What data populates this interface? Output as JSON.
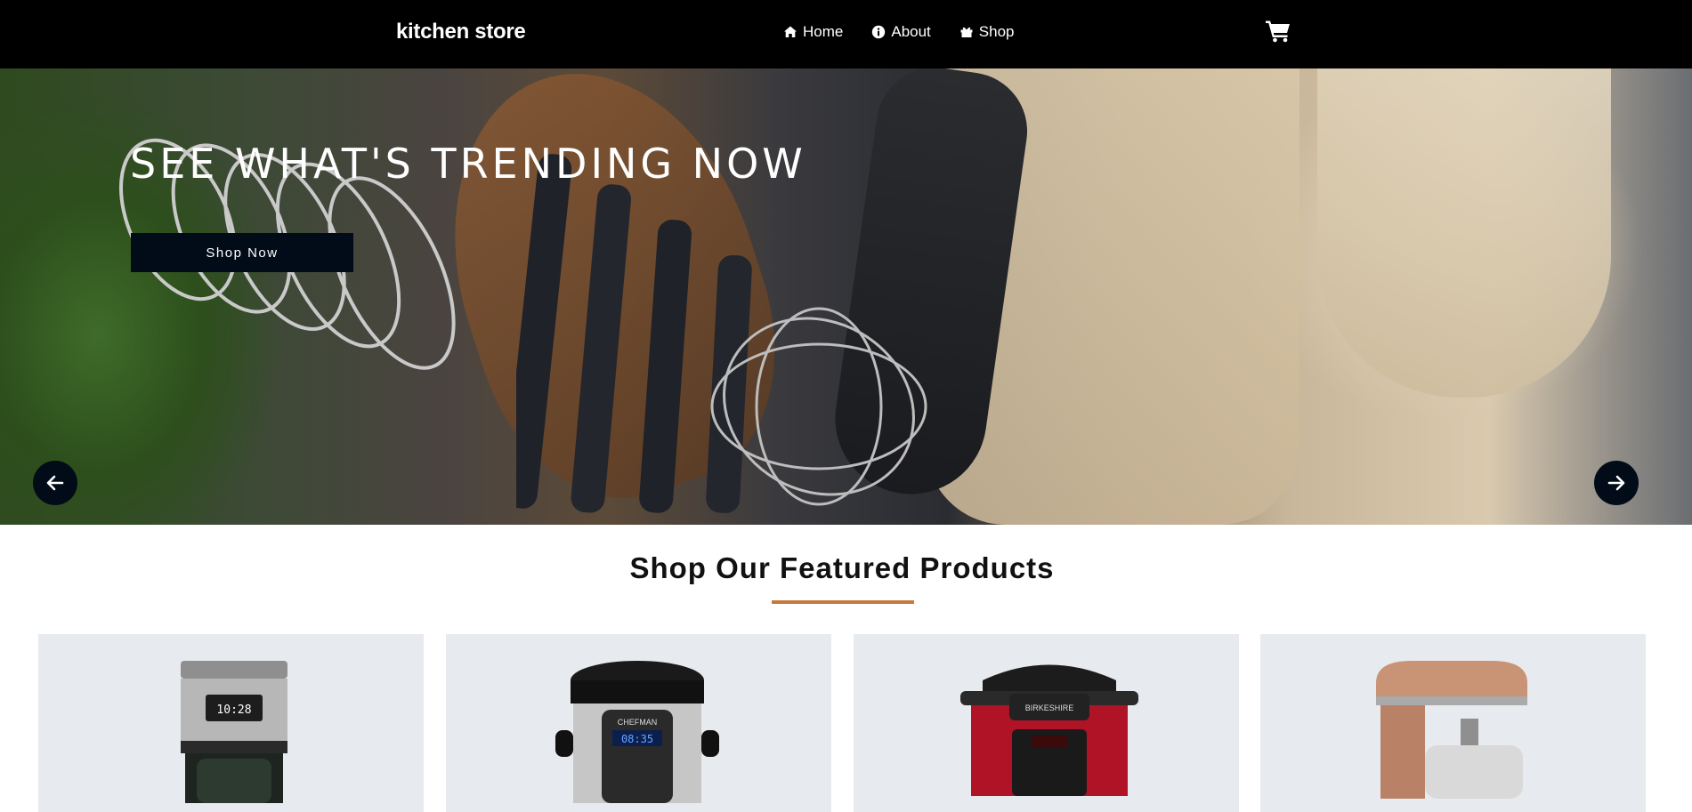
{
  "navbar": {
    "brand": "kitchen store",
    "links": [
      {
        "label": "Home",
        "icon": "home-icon"
      },
      {
        "label": "About",
        "icon": "info-icon"
      },
      {
        "label": "Shop",
        "icon": "gift-icon"
      }
    ],
    "cart_icon": "cart-icon"
  },
  "hero": {
    "title": "SEE WHAT'S TRENDING NOW",
    "button_label": "Shop Now",
    "prev_icon": "arrow-left-icon",
    "next_icon": "arrow-right-icon"
  },
  "featured": {
    "title": "Shop Our Featured Products",
    "accent_color": "#c47a3c",
    "products": [
      {
        "image": "coffee-maker-image",
        "display_time": "10:28"
      },
      {
        "image": "pressure-cooker-image",
        "brand": "CHEFMAN",
        "display_time": "08:35"
      },
      {
        "image": "red-pressure-cooker-image",
        "brand": "BIRKESHIRE"
      },
      {
        "image": "stand-mixer-image"
      }
    ]
  },
  "colors": {
    "navbar_bg": "#000000",
    "button_bg": "#010c18",
    "card_bg": "#e7eaee"
  }
}
